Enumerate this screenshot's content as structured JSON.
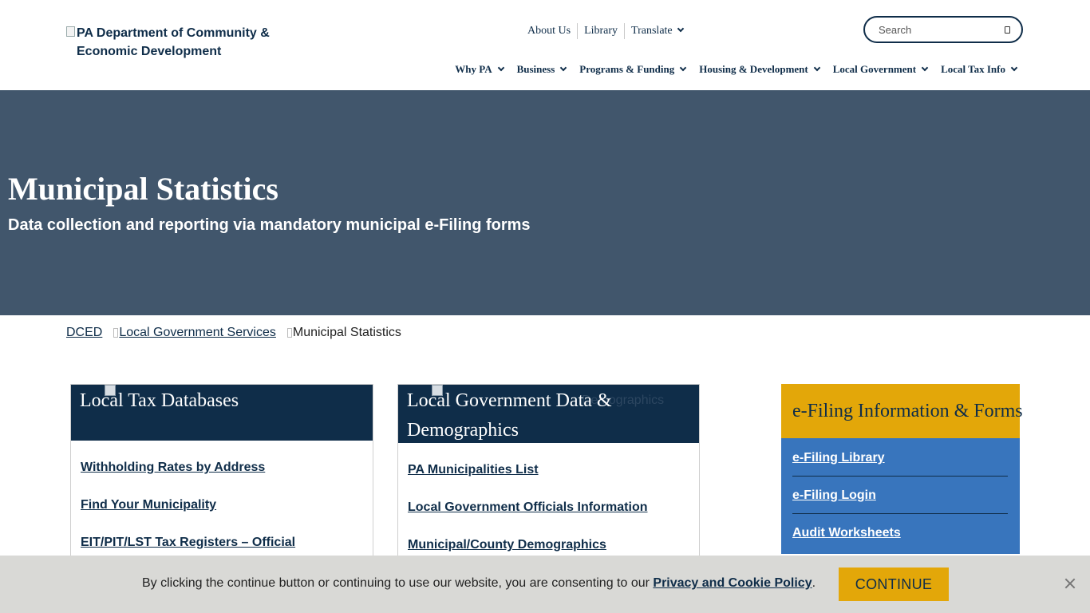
{
  "header": {
    "logo_alt": "PA Department of Community & Economic Development",
    "utility_nav": [
      "About Us",
      "Library",
      "Translate"
    ],
    "search_placeholder": "Search",
    "main_nav": [
      "Why PA",
      "Business",
      "Programs & Funding",
      "Housing & Development",
      "Local Government",
      "Local Tax Info"
    ]
  },
  "hero": {
    "title": "Municipal Statistics",
    "subtitle": "Data collection and reporting via mandatory municipal e-Filing forms"
  },
  "breadcrumb": [
    "DCED",
    "Local Government Services",
    "Municipal Statistics"
  ],
  "cards": [
    {
      "title": "Local Tax Databases",
      "links": [
        "Withholding Rates by Address",
        "Find Your Municipality",
        "EIT/PIT/LST Tax Registers – Official"
      ]
    },
    {
      "title": "Local Government Data & Demographics",
      "image_alt": "Demographics",
      "links": [
        "PA Municipalities List",
        "Local Government Officials Information",
        "Municipal/County Demographics"
      ]
    }
  ],
  "efiling": {
    "title": "e-Filing Information & Forms",
    "links": [
      "e-Filing Library",
      "e-Filing Login",
      "Audit Worksheets"
    ]
  },
  "cookie": {
    "message": "By clicking the continue button or continuing to use our website, you are consenting to our ",
    "policy_link": "Privacy and Cookie Policy",
    "period": ".",
    "button": "CONTINUE"
  },
  "colors": {
    "navy": "#0f2d49",
    "hero_bg": "#41566c",
    "gold": "#e3a709",
    "blue_panel": "#3875bd",
    "cookie_bg": "#d9d9d6"
  }
}
